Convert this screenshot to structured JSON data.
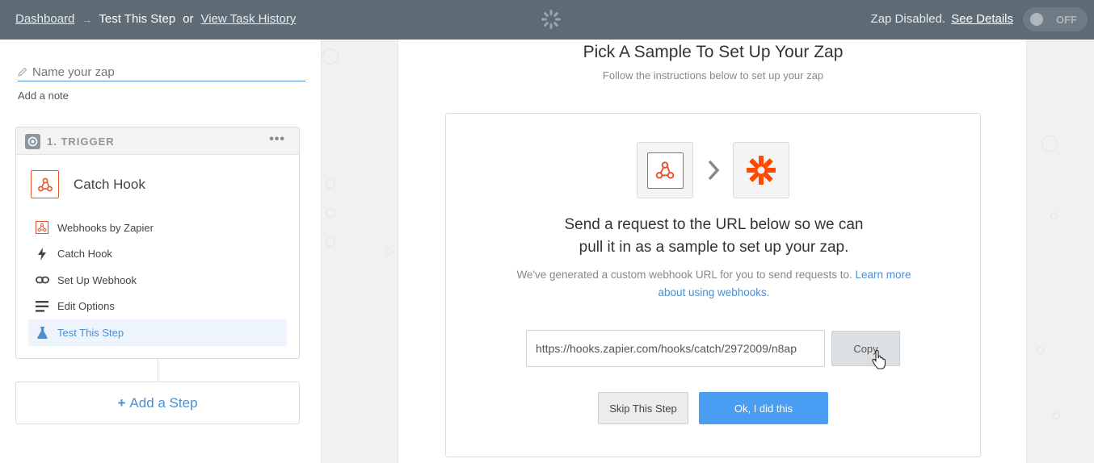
{
  "header": {
    "crumb_dashboard": "Dashboard",
    "crumb_arrow": "→",
    "crumb_current": "Test This Step",
    "crumb_or": "or",
    "crumb_history": "View Task History",
    "status_text": "Zap Disabled.",
    "status_link": "See Details",
    "toggle_label": "OFF"
  },
  "sidebar": {
    "zap_name_placeholder": "Name your zap",
    "add_note": "Add a note",
    "trigger_label": "1. TRIGGER",
    "trigger_app_title": "Catch Hook",
    "steps": [
      {
        "label": "Webhooks by Zapier",
        "icon": "webhook-icon"
      },
      {
        "label": "Catch Hook",
        "icon": "bolt-icon"
      },
      {
        "label": "Set Up Webhook",
        "icon": "link-icon"
      },
      {
        "label": "Edit Options",
        "icon": "list-icon"
      },
      {
        "label": "Test This Step",
        "icon": "flask-icon"
      }
    ],
    "add_step": "Add a Step"
  },
  "main": {
    "title": "Pick A Sample To Set Up Your Zap",
    "subtitle": "Follow the instructions below to set up your zap",
    "request_line1": "Send a request to the URL below so we can",
    "request_line2": "pull it in as a sample to set up your zap.",
    "desc_text": "We've generated a custom webhook URL for you to send requests to. ",
    "desc_link": "Learn more about using webhooks.",
    "webhook_url": "https://hooks.zapier.com/hooks/catch/2972009/n8ap",
    "copy_label": "Copy",
    "skip_label": "Skip This Step",
    "ok_label": "Ok, I did this"
  },
  "colors": {
    "topbar": "#5e6b75",
    "accent_blue": "#4a8fd1",
    "primary_button": "#499df3",
    "zapier_orange": "#ff4a00",
    "webhook_orange": "#e8522b"
  }
}
